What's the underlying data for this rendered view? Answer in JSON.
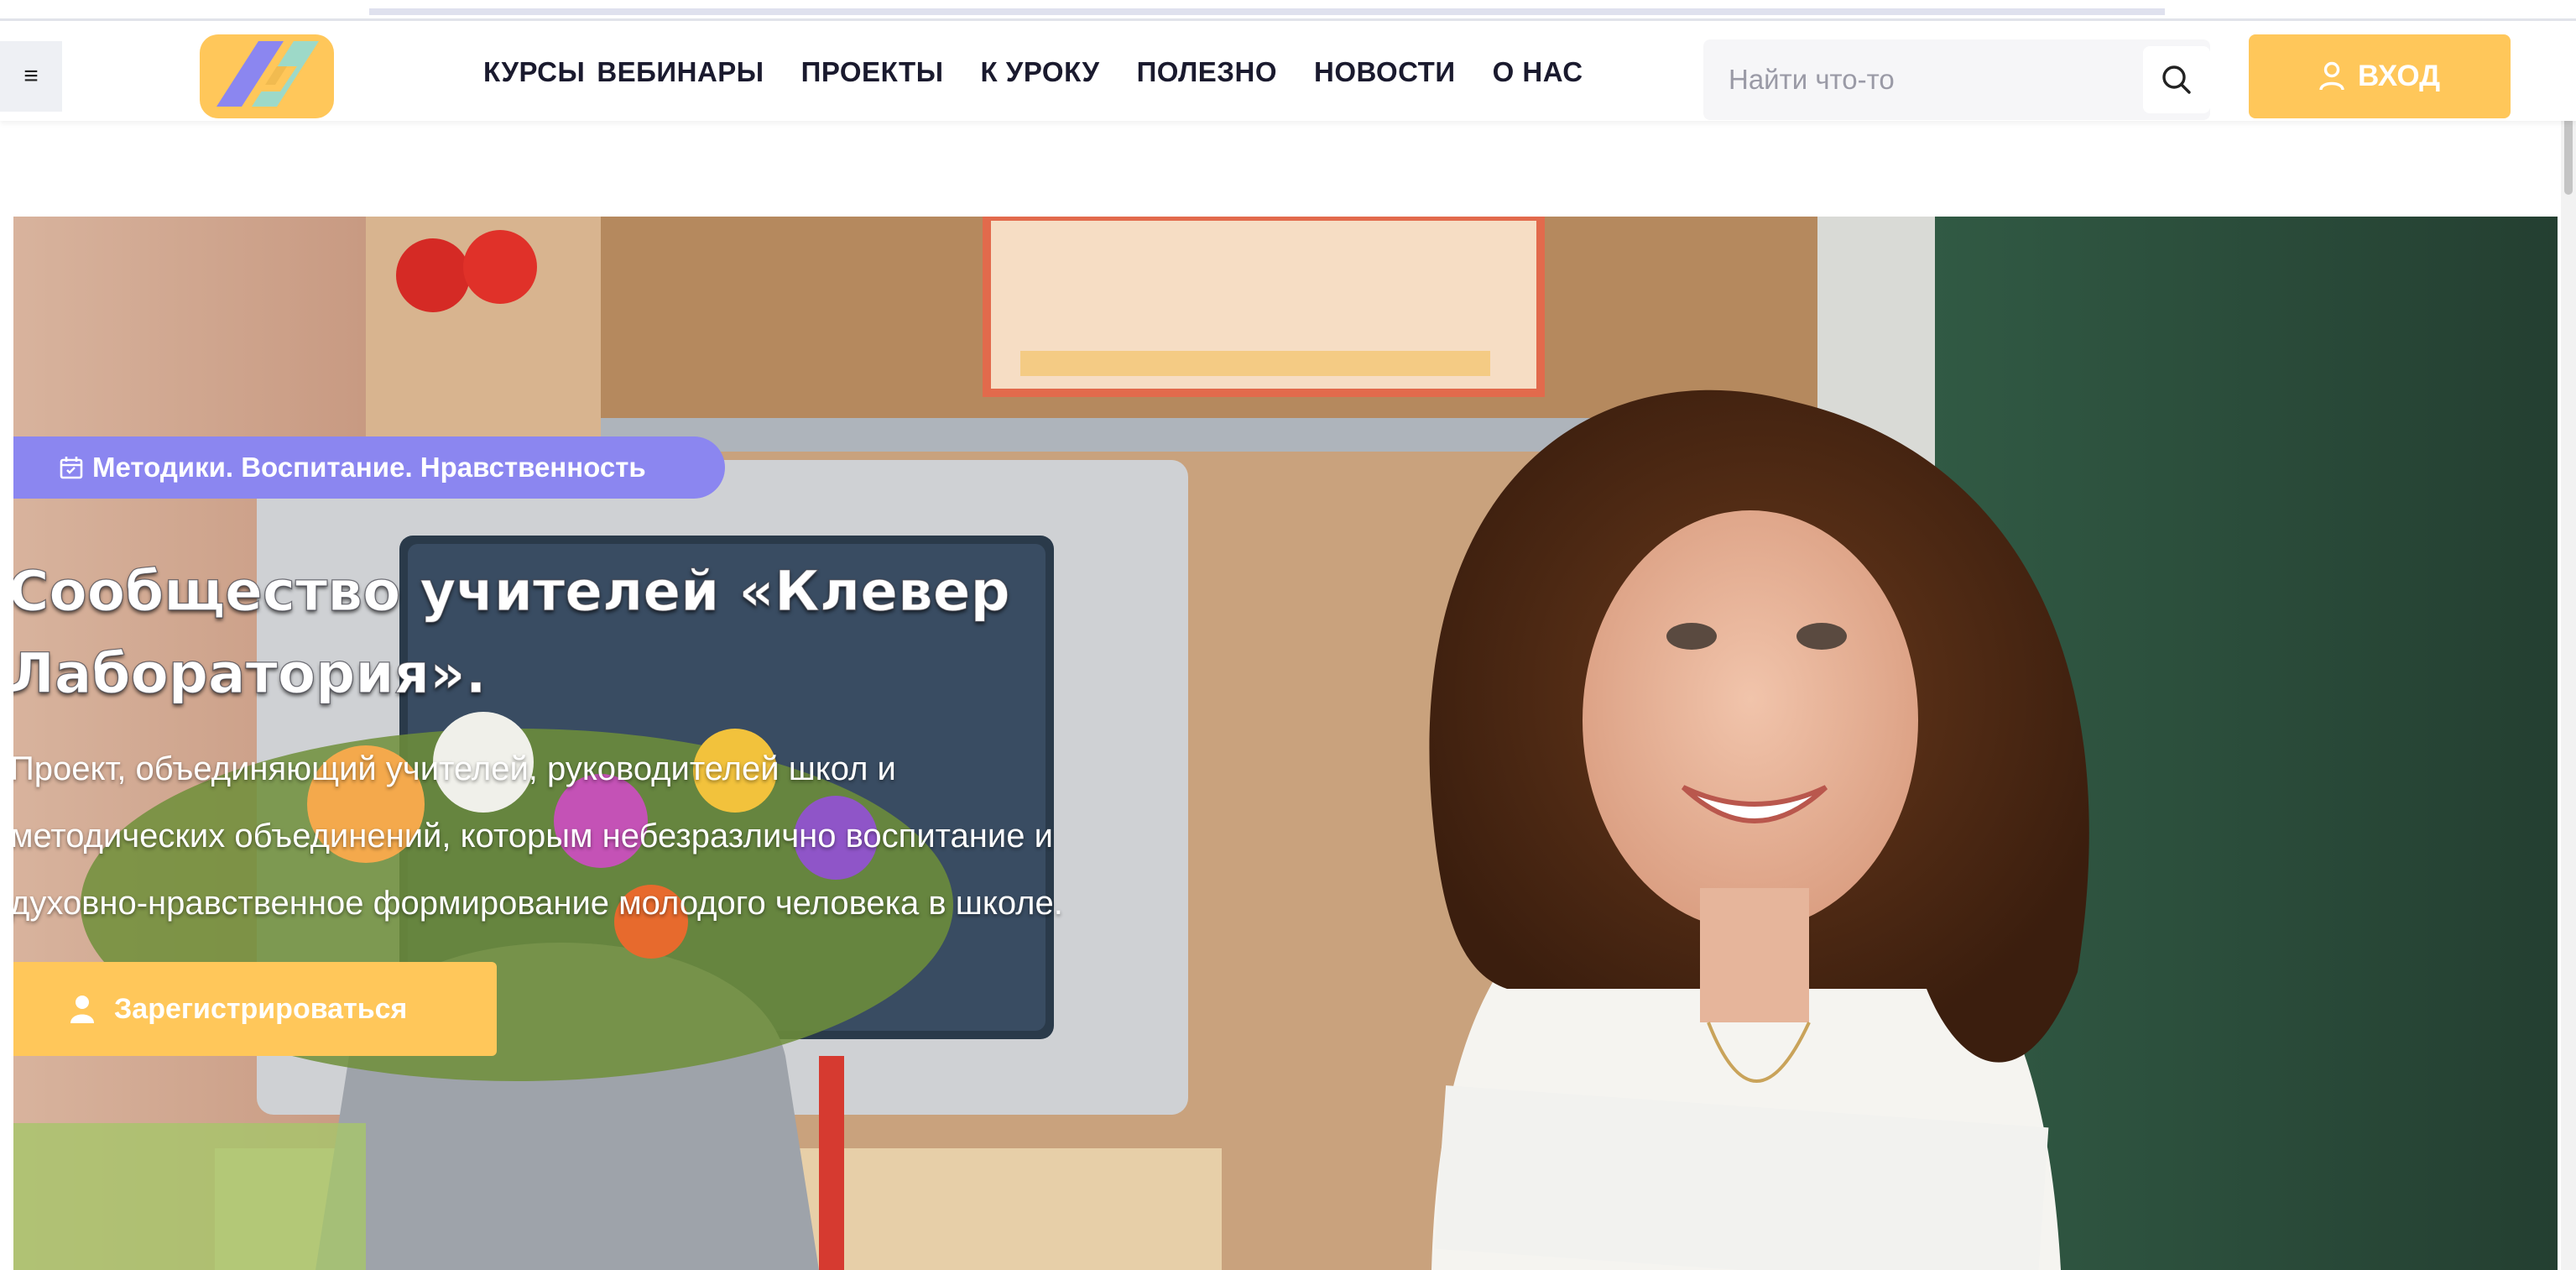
{
  "nav": {
    "items": [
      "КУРСЫ",
      "ВЕБИНАРЫ",
      "ПРОЕКТЫ",
      "К УРОКУ",
      "ПОЛЕЗНО",
      "НОВОСТИ",
      "О НАС"
    ]
  },
  "search": {
    "placeholder": "Найти что-то"
  },
  "header": {
    "login_label": "ВХОД"
  },
  "hero": {
    "tag": "Методики. Воспитание. Нравственность",
    "title_line1": "Сообщество учителей «Клевер",
    "title_line2": "Лаборатория».",
    "desc_line1": "Проект, объединяющий учителей, руководителей школ и",
    "desc_line2": "методических объединений, которым небезразлично воспитание и",
    "desc_line3": "духовно-нравственное формирование молодого человека в школе.",
    "register_label": "Зарегистрироваться"
  },
  "colors": {
    "accent_yellow": "#ffc75a",
    "accent_purple": "#8b86f0",
    "nav_text": "#1a1a2e",
    "banner_text": "#1b2a86"
  },
  "icons": {
    "menu": "hamburger-icon",
    "search": "search-icon",
    "login": "user-icon",
    "tag": "calendar-icon",
    "register": "user-icon"
  }
}
